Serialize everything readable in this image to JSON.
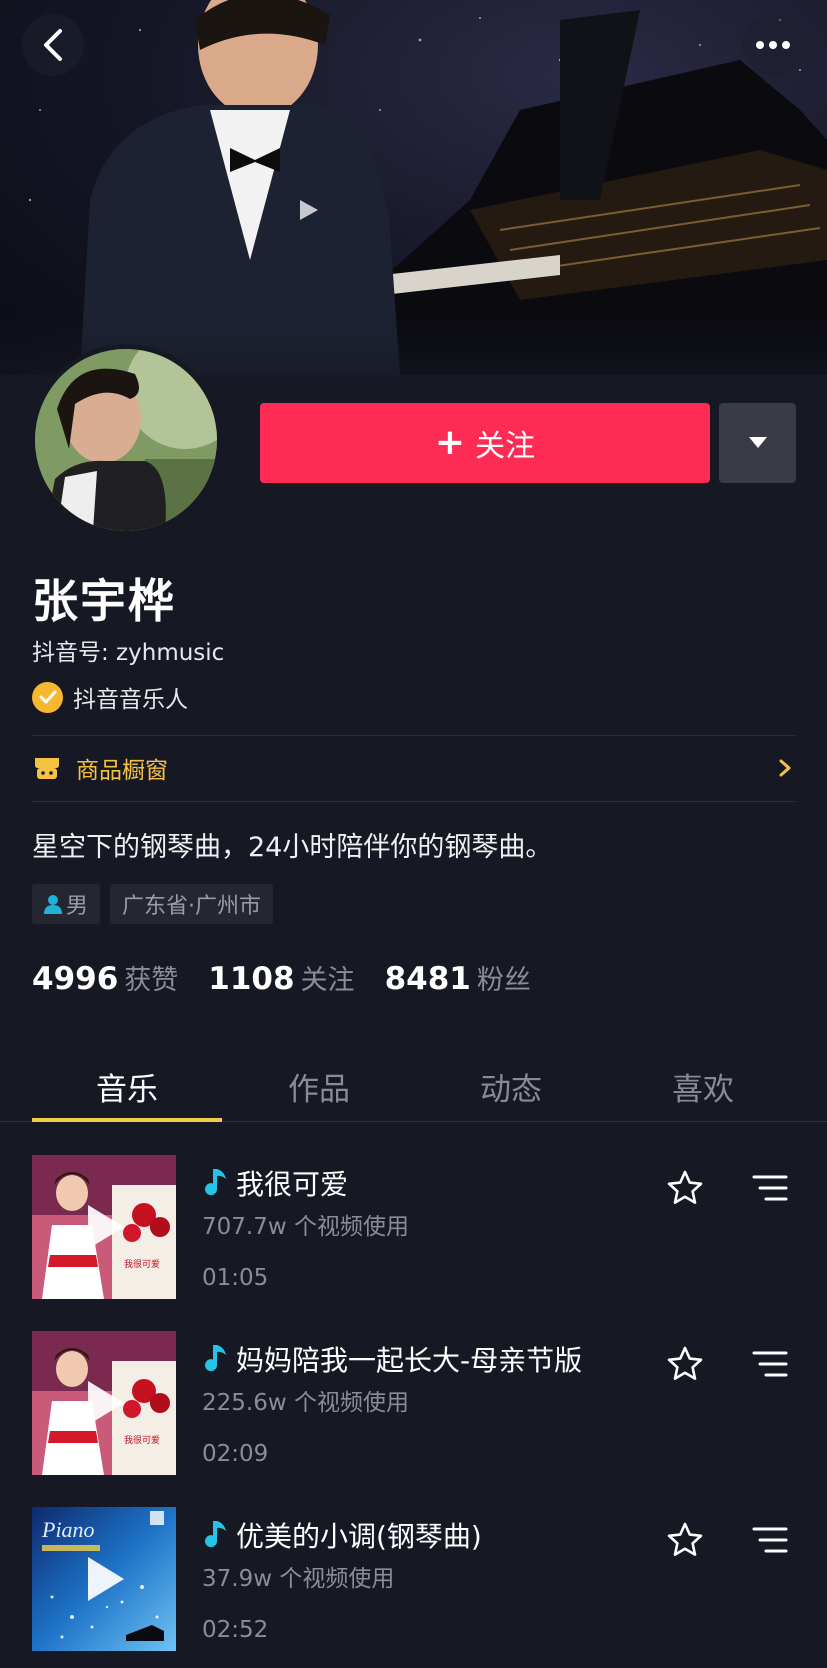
{
  "profile": {
    "name": "张宇桦",
    "douyin_id": "抖音号: zyhmusic",
    "verified_label": "抖音音乐人",
    "follow_label": "关注",
    "follow_plus": "+",
    "bio": "星空下的钢琴曲，24小时陪伴你的钢琴曲。",
    "gender": "男",
    "location": "广东省·广州市"
  },
  "shop": {
    "label": "商品橱窗"
  },
  "stats": [
    {
      "value": "4996",
      "label": "获赞"
    },
    {
      "value": "1108",
      "label": "关注"
    },
    {
      "value": "8481",
      "label": "粉丝"
    }
  ],
  "tabs": [
    {
      "label": "音乐",
      "active": true
    },
    {
      "label": "作品",
      "active": false
    },
    {
      "label": "动态",
      "active": false
    },
    {
      "label": "喜欢",
      "active": false
    }
  ],
  "songs": [
    {
      "title": "我很可爱",
      "uses": "707.7w 个视频使用",
      "duration": "01:05",
      "cover": "girl-roses"
    },
    {
      "title": "妈妈陪我一起长大-母亲节版",
      "uses": "225.6w 个视频使用",
      "duration": "02:09",
      "cover": "girl-roses"
    },
    {
      "title": "优美的小调(钢琴曲)",
      "uses": "37.9w 个视频使用",
      "duration": "02:52",
      "cover": "blue-piano"
    }
  ],
  "colors": {
    "background": "#161823",
    "follow_button": "#fe2c55",
    "tab_indicator": "#f7c945",
    "shop_text": "#f5c242",
    "verified_badge": "#f7b731",
    "music_note": "#25c4e6"
  },
  "cover_text": {
    "piano_script": "Piano",
    "cover_caption": "我很可爱"
  }
}
